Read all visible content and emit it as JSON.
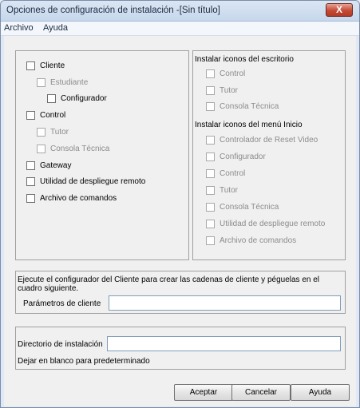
{
  "window": {
    "title": "Opciones de configuración de instalación -[Sin título]",
    "close_label": "X"
  },
  "menu": [
    "Archivo",
    "Ayuda"
  ],
  "components": [
    {
      "label": "Cliente",
      "checked": false,
      "enabled": true
    },
    {
      "label": "Estudiante",
      "checked": false,
      "enabled": false
    },
    {
      "label": "Configurador",
      "checked": false,
      "enabled": true
    },
    {
      "label": "Control",
      "checked": false,
      "enabled": true
    },
    {
      "label": "Tutor",
      "checked": false,
      "enabled": false
    },
    {
      "label": "Consola Técnica",
      "checked": false,
      "enabled": false
    },
    {
      "label": "Gateway",
      "checked": false,
      "enabled": true
    },
    {
      "label": "Utilidad de despliegue remoto",
      "checked": false,
      "enabled": true
    },
    {
      "label": "Archivo de comandos",
      "checked": false,
      "enabled": true
    }
  ],
  "desktop_icons": {
    "heading": "Instalar iconos del escritorio",
    "items": [
      "Control",
      "Tutor",
      "Consola Técnica"
    ]
  },
  "start_menu_icons": {
    "heading": "Instalar iconos del menú Inicio",
    "items": [
      "Controlador de Reset Video",
      "Configurador",
      "Control",
      "Tutor",
      "Consola Técnica",
      "Utilidad de despliegue remoto",
      "Archivo de comandos"
    ]
  },
  "client_params": {
    "description": "Ejecute el configurador del Cliente para crear las cadenas de cliente y péguelas en el cuadro siguiente.",
    "label": "Parámetros de cliente",
    "value": ""
  },
  "install_dir": {
    "label": "Directorio de instalación",
    "value": "",
    "hint": "Dejar en blanco para predeterminado"
  },
  "buttons": {
    "ok": "Aceptar",
    "cancel": "Cancelar",
    "help": "Ayuda"
  }
}
